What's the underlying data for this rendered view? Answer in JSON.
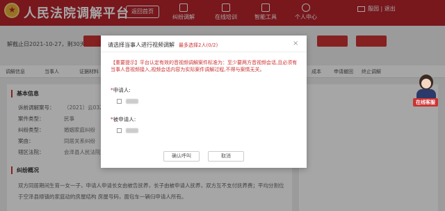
{
  "header": {
    "site_title": "人民法院调解平台",
    "home_button": "返回首页",
    "nav": [
      {
        "label": "纠纷调解",
        "icon": "dispute-icon"
      },
      {
        "label": "在线培训",
        "icon": "training-icon"
      },
      {
        "label": "智能工具",
        "icon": "tools-icon"
      },
      {
        "label": "个人中心",
        "icon": "user-icon"
      }
    ],
    "user_links": "殷园 | 退出"
  },
  "background": {
    "deadline": "解截止日2021-10-27，剩30天",
    "tabs": [
      "调解信息",
      "当事人",
      "证据材料",
      "成本",
      "申请撤回",
      "终止调解"
    ],
    "basic_info_title": "基本信息",
    "fields": [
      {
        "label": "诉前调解案号：",
        "value": "（2021）云0326民"
      },
      {
        "label": "案件类型：",
        "value": "民事"
      },
      {
        "label": "纠纷类型：",
        "value": "婚姻家庭纠纷"
      },
      {
        "label": "案由：",
        "value": "同居关系纠纷"
      },
      {
        "label": "辖区法院：",
        "value": "会泽县人民法院"
      }
    ],
    "overview_title": "纠纷概况",
    "overview_lines": [
      "双方同居期间生育一女一子，申请人申请长女由被告抚养，长子由被申请人抚养，双方互不支付抚养费；平均分割位",
      "于空泽县顺镇的家庭动的房屋结构 房屋号码，面包车一辆归申请人所有。"
    ]
  },
  "agent_badge": "在线客服",
  "modal": {
    "title": "请选择当事人进行视频调解",
    "subtitle": "最多选择2人(0/2)",
    "close": "×",
    "notice": "【重要提示】平台认定有效的音视频调解案件标准为：至少要两方音视频会话,且必须有当事人音视频接入,视频会话内容为实际案件调解过程,不得与案情无关。",
    "applicant_label": "申请人:",
    "respondent_label": "被申请人:",
    "confirm": "确认呼叫",
    "cancel": "取消"
  }
}
